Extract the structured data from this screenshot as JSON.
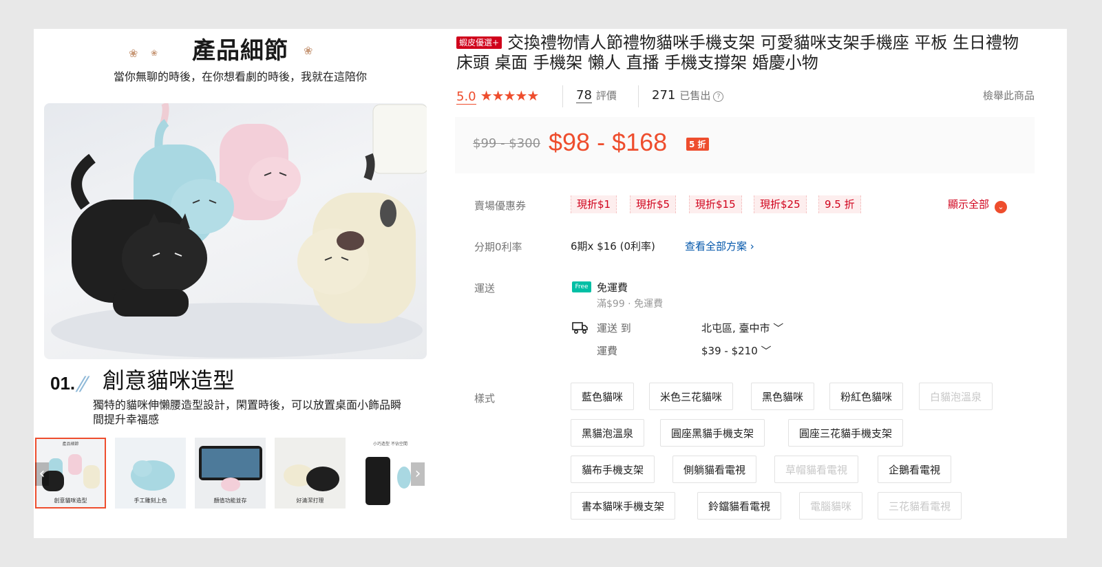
{
  "gallery": {
    "hero_title": "產品細節",
    "hero_subtitle": "當你無聊的時後，在你想看劇的時後，我就在這陪你",
    "feature_number": "01.",
    "feature_title": "創意貓咪造型",
    "feature_desc": "獨特的貓咪伸懶腰造型設計，閑置時後，可以放置桌面小飾品瞬間提升幸福感",
    "thumbnails": [
      {
        "caption": "創意貓咪造型",
        "mini": "產品細節"
      },
      {
        "caption": "手工雕刻上色",
        "mini": ""
      },
      {
        "caption": "顏值功能並存",
        "mini": ""
      },
      {
        "caption": "好清潔打理",
        "mini": ""
      },
      {
        "caption": "",
        "mini": "小巧造型 不佔空間"
      }
    ],
    "prev_arrow": "‹",
    "next_arrow": "›"
  },
  "product": {
    "preferred_badge": "蝦皮優選+",
    "title": "交換禮物情人節禮物貓咪手機支架 可愛貓咪支架手機座 平板 生日禮物 床頭 桌面 手機架 懶人 直播 手機支撐架 婚慶小物",
    "rating": "5.0",
    "stars": "★★★★★",
    "reviews_count": "78",
    "reviews_label": "評價",
    "sold_count": "271",
    "sold_label": "已售出",
    "help_icon": "?",
    "report_label": "檢舉此商品"
  },
  "price": {
    "original": "$99 - $300",
    "current": "$98 - $168",
    "discount": "5 折"
  },
  "vouchers": {
    "label": "賣場優惠券",
    "items": [
      "現折$1",
      "現折$5",
      "現折$15",
      "現折$25",
      "9.5 折"
    ],
    "show_all": "顯示全部",
    "show_all_icon": "⌄"
  },
  "installment": {
    "label": "分期0利率",
    "value": "6期x $16 (0利率)",
    "link": "查看全部方案 ›"
  },
  "shipping": {
    "label": "運送",
    "free_icon": "Free",
    "free_text": "免運費",
    "free_sub": "滿$99 · 免運費",
    "to_label": "運送 到",
    "to_value": "北屯區, 臺中市 ﹀",
    "fee_label": "運費",
    "fee_value": "$39 - $210 ﹀"
  },
  "variants": {
    "label": "樣式",
    "items": [
      {
        "name": "藍色貓咪",
        "available": true
      },
      {
        "name": "米色三花貓咪",
        "available": true
      },
      {
        "name": "黑色貓咪",
        "available": true
      },
      {
        "name": "粉紅色貓咪",
        "available": true
      },
      {
        "name": "白貓泡溫泉",
        "available": false
      },
      {
        "name": "黑貓泡溫泉",
        "available": true
      },
      {
        "name": "圓座黑貓手機支架",
        "available": true
      },
      {
        "name": "圓座三花貓手機支架",
        "available": true
      },
      {
        "name": "貓布手機支架",
        "available": true
      },
      {
        "name": "側躺貓看電視",
        "available": true
      },
      {
        "name": "草帽貓看電視",
        "available": false
      },
      {
        "name": "企鵝看電視",
        "available": true
      },
      {
        "name": "書本貓咪手機支架",
        "available": true
      },
      {
        "name": "鈴鐺貓看電視",
        "available": true
      },
      {
        "name": "電腦貓咪",
        "available": false
      },
      {
        "name": "三花貓看電視",
        "available": false
      }
    ]
  },
  "colors": {
    "accent": "#ee4d2d",
    "voucher_text": "#d0011b",
    "link": "#0055aa"
  }
}
